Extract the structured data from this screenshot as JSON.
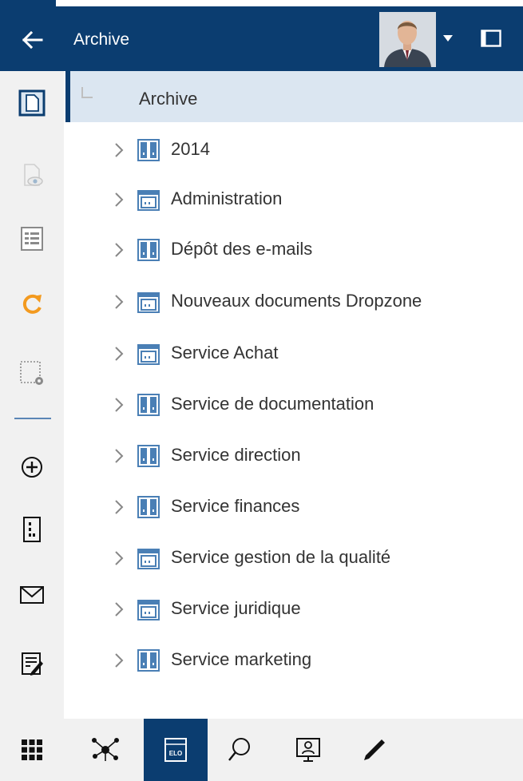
{
  "header": {
    "title": "Archive",
    "back_icon": "arrow-left-icon",
    "avatar_icon": "user-avatar",
    "menu_icon": "caret-down-icon",
    "panel_icon": "panel-toggle-icon"
  },
  "sidebar": {
    "items": [
      {
        "icon": "new-document-icon",
        "active": true
      },
      {
        "icon": "preview-icon",
        "disabled": true
      },
      {
        "icon": "list-view-icon"
      },
      {
        "icon": "refresh-icon"
      },
      {
        "icon": "selection-settings-icon"
      },
      {
        "icon": "add-circle-icon"
      },
      {
        "icon": "folder-register-icon"
      },
      {
        "icon": "mail-icon"
      },
      {
        "icon": "edit-form-icon"
      }
    ]
  },
  "tree": {
    "root": {
      "label": "Archive"
    },
    "items": [
      {
        "label": "2014",
        "icon": "cabinet-icon"
      },
      {
        "label": "Administration",
        "icon": "drawer-icon"
      },
      {
        "label": "Dépôt des e-mails",
        "icon": "cabinet-icon"
      },
      {
        "label": "Nouveaux documents Dropzone",
        "icon": "drawer-icon"
      },
      {
        "label": "Service Achat",
        "icon": "drawer-icon"
      },
      {
        "label": "Service de documentation",
        "icon": "cabinet-icon"
      },
      {
        "label": "Service direction",
        "icon": "cabinet-icon"
      },
      {
        "label": "Service finances",
        "icon": "cabinet-icon"
      },
      {
        "label": "Service gestion de la qualité",
        "icon": "drawer-icon"
      },
      {
        "label": "Service juridique",
        "icon": "drawer-icon"
      },
      {
        "label": "Service marketing",
        "icon": "cabinet-icon"
      }
    ]
  },
  "bottombar": {
    "items": [
      {
        "icon": "apps-grid-icon"
      },
      {
        "icon": "network-icon"
      },
      {
        "icon": "elo-archive-icon",
        "active": true,
        "badge": "ELO"
      },
      {
        "icon": "search-icon"
      },
      {
        "icon": "workflow-user-icon"
      },
      {
        "icon": "pen-icon"
      }
    ]
  },
  "colors": {
    "primary": "#0b3d70",
    "accent_orange": "#f39a1f",
    "selected_row": "#dbe6f1",
    "sidebar_bg": "#f1f1f1",
    "cabinet_blue": "#4a7fb5"
  }
}
